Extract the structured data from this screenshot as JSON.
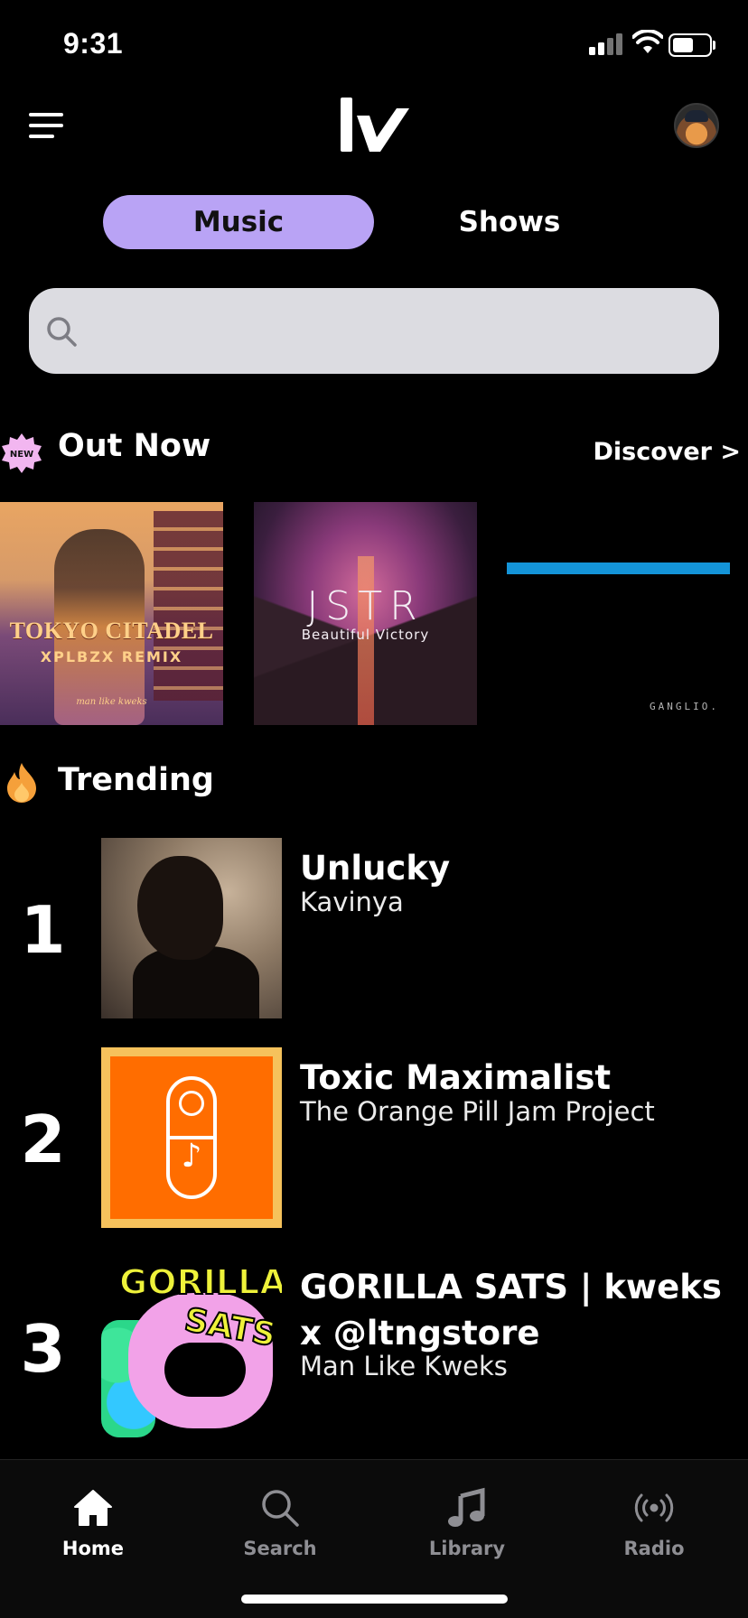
{
  "status_bar": {
    "time": "9:31"
  },
  "tabs": [
    {
      "label": "Music",
      "active": true
    },
    {
      "label": "Shows",
      "active": false
    }
  ],
  "search": {
    "placeholder": "",
    "value": ""
  },
  "out_now": {
    "badge": "NEW",
    "title": "Out Now",
    "discover_label": "Discover >",
    "albums": [
      {
        "title": "TOKYO CITADEL",
        "subtitle": "XPLBZX REMIX",
        "signature": "man like kweks"
      },
      {
        "title": "JSTR",
        "subtitle": "Beautiful Victory"
      },
      {
        "label": "GANGLIO."
      }
    ]
  },
  "trending": {
    "title": "Trending",
    "items": [
      {
        "rank": "1",
        "title": "Unlucky",
        "artist": "Kavinya"
      },
      {
        "rank": "2",
        "title": "Toxic Maximalist",
        "artist": "The Orange Pill Jam Project"
      },
      {
        "rank": "3",
        "title": "GORILLA SATS | kweks x @ltngstore",
        "artist": "Man Like Kweks",
        "art_title": "GORILLA",
        "art_sub": "SATS"
      }
    ]
  },
  "bottom_nav": [
    {
      "label": "Home",
      "icon": "home-icon",
      "active": true
    },
    {
      "label": "Search",
      "icon": "search-icon",
      "active": false
    },
    {
      "label": "Library",
      "icon": "music-note-icon",
      "active": false
    },
    {
      "label": "Radio",
      "icon": "radio-icon",
      "active": false
    }
  ],
  "colors": {
    "accent": "#b9a3f5",
    "background": "#000000",
    "search_bg": "#dcdce1",
    "nav_inactive": "#8e8e93",
    "new_badge": "#f2b6f0",
    "flame": "#f5a03a"
  }
}
